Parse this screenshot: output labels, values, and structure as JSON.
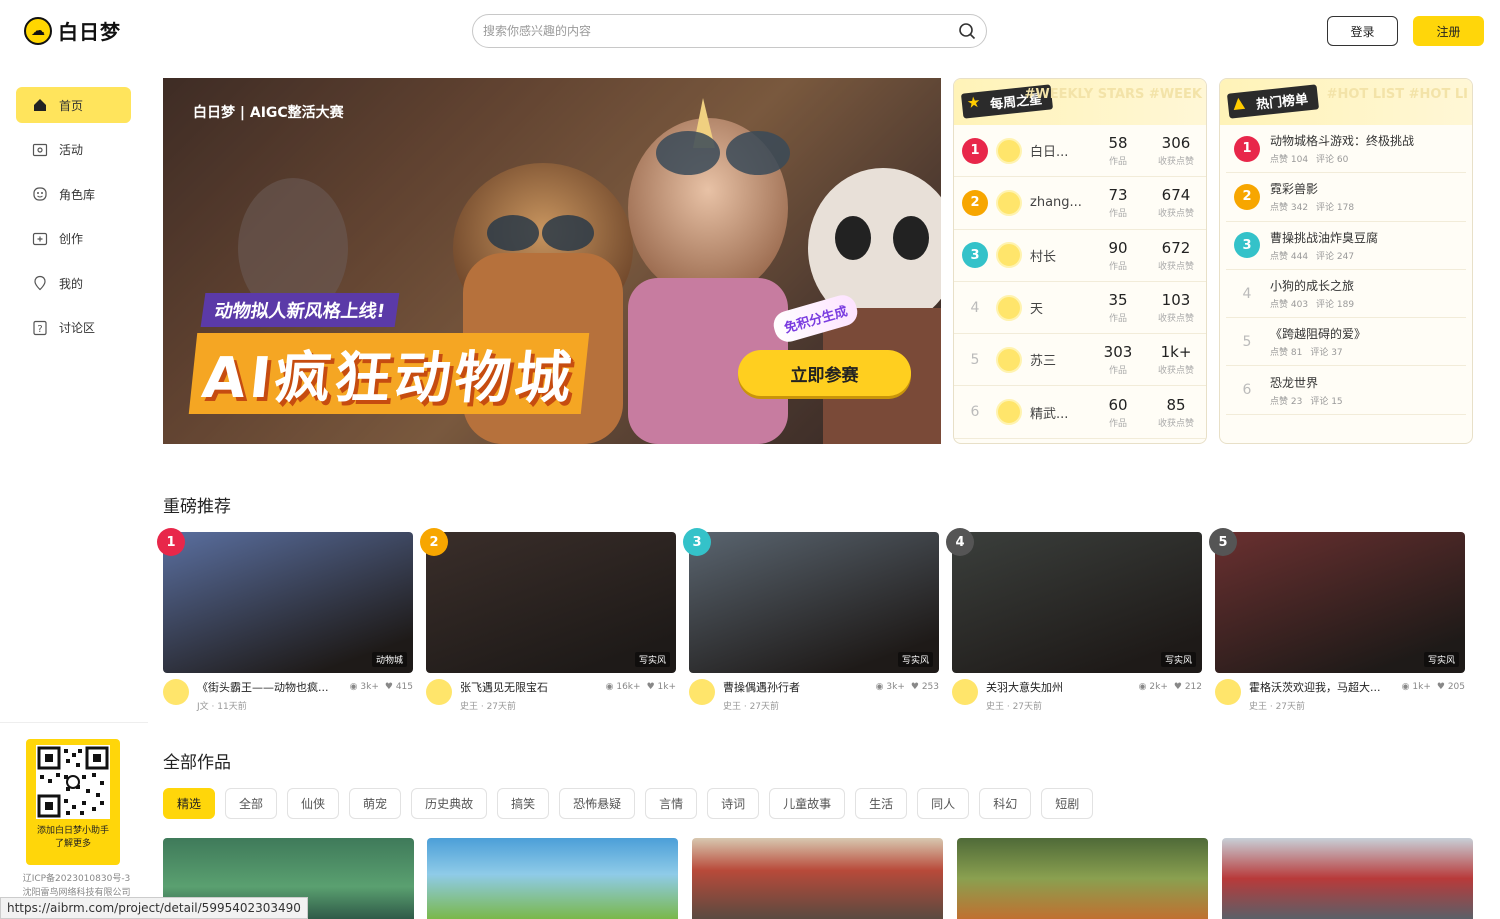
{
  "header": {
    "logo_text": "白日梦",
    "search_placeholder": "搜索你感兴趣的内容",
    "login": "登录",
    "register": "注册"
  },
  "sidebar": {
    "items": [
      {
        "label": "首页",
        "icon": "home-icon"
      },
      {
        "label": "活动",
        "icon": "activity-icon"
      },
      {
        "label": "角色库",
        "icon": "character-icon"
      },
      {
        "label": "创作",
        "icon": "create-icon"
      },
      {
        "label": "我的",
        "icon": "profile-icon"
      },
      {
        "label": "讨论区",
        "icon": "discussion-icon"
      }
    ],
    "qr_text_1": "添加白日梦小助手",
    "qr_text_2": "了解更多",
    "icp_1": "辽ICP备2023010830号-3",
    "icp_2": "沈阳雷鸟网络科技有限公司"
  },
  "banner": {
    "brand": "白日梦 | AIGC整活大赛",
    "tagline": "动物拟人新风格上线!",
    "title": "AI疯狂动物城",
    "badge": "免积分生成",
    "cta": "立即参赛"
  },
  "weekly": {
    "title": "每周之星",
    "watermark": "#WEEKLY STARS #WEEK",
    "works_label": "作品",
    "likes_label": "收获点赞",
    "rows": [
      {
        "rank": "1",
        "name": "白日...",
        "works": "58",
        "likes": "306"
      },
      {
        "rank": "2",
        "name": "zhang...",
        "works": "73",
        "likes": "674"
      },
      {
        "rank": "3",
        "name": "村长",
        "works": "90",
        "likes": "672"
      },
      {
        "rank": "4",
        "name": "天",
        "works": "35",
        "likes": "103"
      },
      {
        "rank": "5",
        "name": "苏三",
        "works": "303",
        "likes": "1k+"
      },
      {
        "rank": "6",
        "name": "精武...",
        "works": "60",
        "likes": "85"
      }
    ]
  },
  "hot": {
    "title": "热门榜单",
    "watermark": "#HOT LIST #HOT LI",
    "rows": [
      {
        "rank": "1",
        "title": "动物城格斗游戏：终极挑战",
        "likes": "点赞 104",
        "comments": "评论 60"
      },
      {
        "rank": "2",
        "title": "霓彩兽影",
        "likes": "点赞 342",
        "comments": "评论 178"
      },
      {
        "rank": "3",
        "title": "曹操挑战油炸臭豆腐",
        "likes": "点赞 444",
        "comments": "评论 247"
      },
      {
        "rank": "4",
        "title": "小狗的成长之旅",
        "likes": "点赞 403",
        "comments": "评论 189"
      },
      {
        "rank": "5",
        "title": "《跨越阻碍的爱》",
        "likes": "点赞 81",
        "comments": "评论 37"
      },
      {
        "rank": "6",
        "title": "恐龙世界",
        "likes": "点赞 23",
        "comments": "评论 15"
      }
    ]
  },
  "featured": {
    "title": "重磅推荐",
    "items": [
      {
        "rank": "1",
        "tag": "动物城",
        "name": "《街头霸王——动物也疯...",
        "views": "3k+",
        "likes": "415",
        "author": "J文 · 11天前",
        "color": "#5a6fa0"
      },
      {
        "rank": "2",
        "tag": "写实风",
        "name": "张飞遇见无限宝石",
        "views": "16k+",
        "likes": "1k+",
        "author": "史王 · 27天前",
        "color": "#3a2e2a"
      },
      {
        "rank": "3",
        "tag": "写实风",
        "name": "曹操偶遇孙行者",
        "views": "3k+",
        "likes": "253",
        "author": "史王 · 27天前",
        "color": "#5a6570"
      },
      {
        "rank": "4",
        "tag": "写实风",
        "name": "关羽大意失加州",
        "views": "2k+",
        "likes": "212",
        "author": "史王 · 27天前",
        "color": "#3b3f3c"
      },
      {
        "rank": "5",
        "tag": "写实风",
        "name": "霍格沃茨欢迎我，马超大...",
        "views": "1k+",
        "likes": "205",
        "author": "史王 · 27天前",
        "color": "#6a3030"
      }
    ]
  },
  "all_works": {
    "title": "全部作品",
    "filters": [
      "精选",
      "全部",
      "仙侠",
      "萌宠",
      "历史典故",
      "搞笑",
      "恐怖悬疑",
      "言情",
      "诗词",
      "儿童故事",
      "生活",
      "同人",
      "科幻",
      "短剧"
    ]
  },
  "status_url": "https://aibrm.com/project/detail/5995402303490"
}
